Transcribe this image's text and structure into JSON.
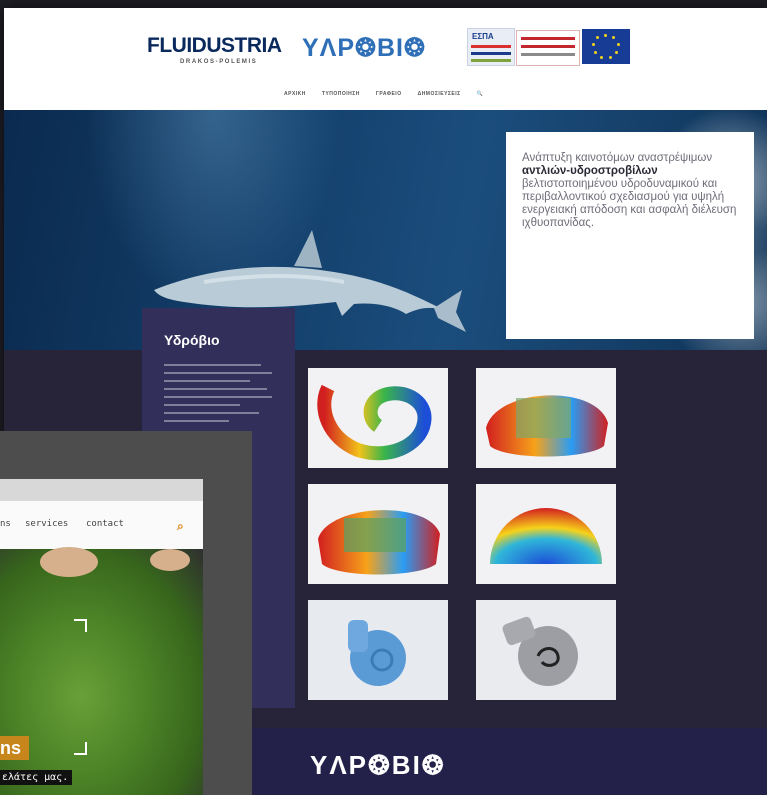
{
  "main_site": {
    "logos": {
      "fluidustria": {
        "part1": "FLUID",
        "part2": "USTRIA",
        "tagline": "DRAKOS-POLEMIS"
      },
      "ydrovio": "YΛΡ❂ΒΙ❂",
      "espa_badge": "ΕΣΠΑ"
    },
    "nav": [
      "ΑΡΧΙΚΗ",
      "ΤΥΠΟΠΟΙΗΣΗ",
      "ΓΡΑΦΕΙΟ",
      "ΔΗΜΟΣΙΕΥΣΕΙΣ",
      "🔍"
    ],
    "hero": {
      "line1": "Ανάπτυξη καινοτόμων αναστρέψιμων",
      "bold": "αντλιών-υδροστροβίλων",
      "rest": "βελτιστοποιημένου υδροδυναμικού και περιβαλλοντικού σχεδιασμού για υψηλή ενεργειακή απόδοση και ασφαλή διέλευση ιχθυοπανίδας."
    },
    "sidebar": {
      "title": "Υδρόβιο"
    },
    "footer_logo": "YΛΡ❂ΒΙ❂"
  },
  "secondary_site": {
    "nav": [
      "ns",
      "services",
      "contact"
    ],
    "badge": "ns",
    "tagline": "ελάτες μας."
  },
  "colors": {
    "nav_dark": "#27243a",
    "sidebar": "#32305a",
    "accent_orange": "#c6861c"
  }
}
